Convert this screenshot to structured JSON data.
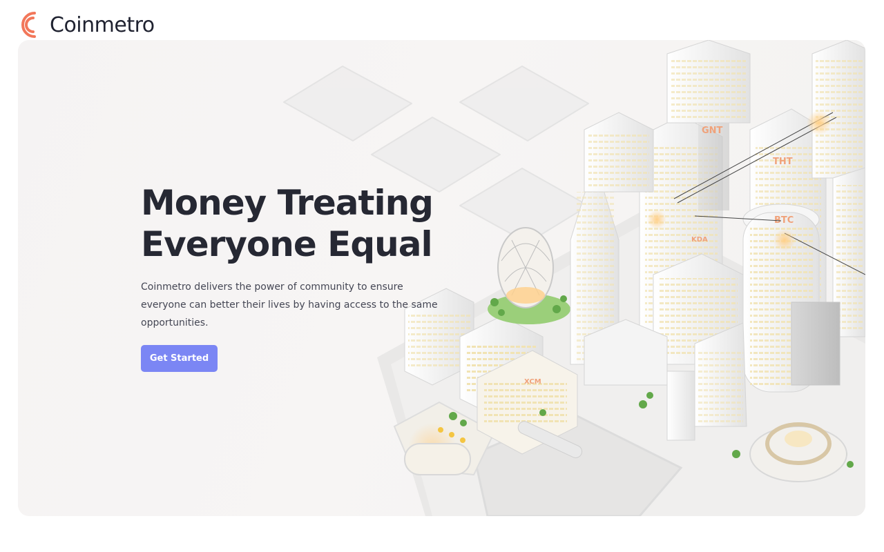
{
  "brand": {
    "name": "Coinmetro",
    "logo_icon": "coinmetro-logo-icon",
    "accent_color": "#f2775a"
  },
  "hero": {
    "headline_line1": "Money Treating",
    "headline_line2": "Everyone Equal",
    "description": "Coinmetro delivers the power of community to ensure everyone can better their lives by having access to the same opportunities.",
    "cta_label": "Get Started",
    "cta_color": "#7b86f4",
    "illustration": "isometric-city-illustration",
    "building_signs": [
      "GNT",
      "THT",
      "BTC",
      "KDA",
      "XCM"
    ]
  }
}
